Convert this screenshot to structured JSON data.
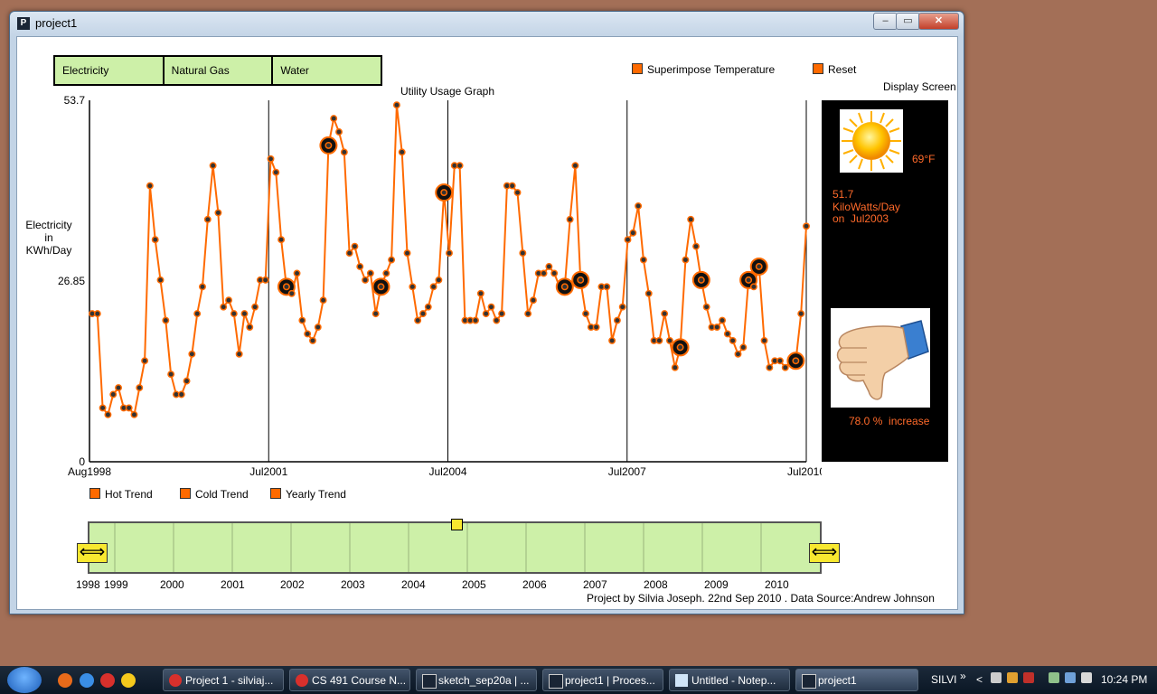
{
  "window": {
    "title": "project1",
    "min": "–",
    "max": "▭",
    "close": "✕"
  },
  "tabs": [
    "Electricity",
    "Natural Gas",
    "Water"
  ],
  "options": {
    "superimpose": "Superimpose Temperature",
    "reset": "Reset",
    "hot": "Hot Trend",
    "cold": "Cold Trend",
    "yearly": "Yearly Trend"
  },
  "chart_data": {
    "type": "line",
    "title": "Utility Usage Graph",
    "ylabel": "Electricity in KWh/Day",
    "ylim": [
      0,
      53.7
    ],
    "y_ticks": [
      "53.7",
      "26.85",
      "0"
    ],
    "x_ticks": [
      "Aug1998",
      "Jul2001",
      "Jul2004",
      "Jul2007",
      "Jul2010"
    ],
    "series": [
      {
        "values": [
          22,
          22,
          8,
          7,
          10,
          11,
          8,
          8,
          7,
          11,
          15,
          41,
          33,
          27,
          21,
          13,
          10,
          10,
          12,
          16,
          22,
          26,
          36,
          44,
          37,
          23,
          24,
          22,
          16,
          22,
          20,
          23,
          27,
          27,
          45,
          43,
          33,
          26,
          25,
          28,
          21,
          19,
          18,
          20,
          24,
          47,
          51,
          49,
          46,
          31,
          32,
          29,
          27,
          28,
          22,
          26,
          28,
          30,
          53,
          46,
          31,
          26,
          21,
          22,
          23,
          26,
          27,
          40,
          31,
          44,
          44,
          21,
          21,
          21,
          25,
          22,
          23,
          21,
          22,
          41,
          41,
          40,
          31,
          22,
          24,
          28,
          28,
          29,
          28,
          26,
          26,
          36,
          44,
          27,
          22,
          20,
          20,
          26,
          26,
          18,
          21,
          23,
          33,
          34,
          38,
          30,
          25,
          18,
          18,
          22,
          18,
          14,
          17,
          30,
          36,
          32,
          27,
          23,
          20,
          20,
          21,
          19,
          18,
          16,
          17,
          27,
          26,
          29,
          18,
          14,
          15,
          15,
          14,
          15,
          15,
          22,
          35
        ]
      }
    ],
    "highlights": [
      37,
      45,
      55,
      67,
      90,
      93,
      112,
      116,
      125,
      127,
      134
    ],
    "axis_color": "#000000",
    "line_color": "#ff6a00"
  },
  "display": {
    "label": "Display Screen",
    "temp": "69°F",
    "usage_value": "51.7",
    "usage_unit": "KiloWatts/Day",
    "usage_on": "on  Jul2003",
    "increase": "78.0 %  increase"
  },
  "timeline": {
    "years": [
      "1998",
      "1999",
      "2000",
      "2001",
      "2002",
      "2003",
      "2004",
      "2005",
      "2006",
      "2007",
      "2008",
      "2009",
      "2010"
    ],
    "left_arrow": "⟺",
    "right_arrow": "⟺"
  },
  "footer": "Project by  Silvia Joseph. 22nd Sep 2010 . Data Source:Andrew Johnson",
  "taskbar": {
    "items": [
      "Project 1 - silviaj...",
      "CS 491 Course N...",
      "sketch_sep20a | ...",
      "project1 | Proces...",
      "Untitled - Notep...",
      "project1"
    ],
    "user": "SILVI",
    "chevron": "»",
    "arrow": "<",
    "time": "10:24 PM"
  }
}
